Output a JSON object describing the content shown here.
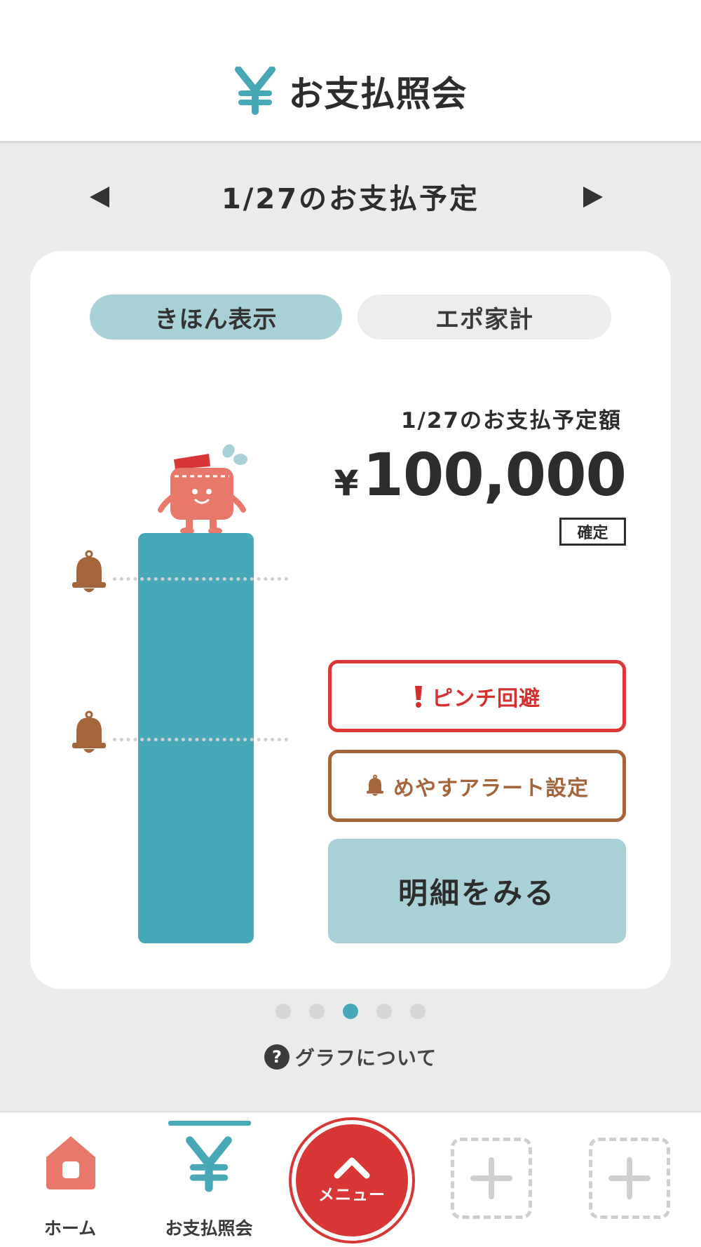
{
  "header": {
    "title": "お支払照会",
    "icon": "yen-icon"
  },
  "date_nav": {
    "title": "1/27のお支払予定",
    "prev_icon": "triangle-left-icon",
    "next_icon": "triangle-right-icon"
  },
  "segment": {
    "options": [
      {
        "label": "きほん表示",
        "selected": true
      },
      {
        "label": "エポ家計",
        "selected": false
      }
    ]
  },
  "summary": {
    "label": "1/27のお支払予定額",
    "currency": "¥",
    "amount": "100,000",
    "status": "確定"
  },
  "buttons": {
    "pinch": "ピンチ回避",
    "alert": "めやすアラート設定",
    "detail": "明細をみる"
  },
  "pager": {
    "count": 5,
    "active_index": 2
  },
  "help": {
    "icon_text": "?",
    "label": "グラフについて"
  },
  "tabbar": {
    "home": "ホーム",
    "payment": "お支払照会",
    "menu": "メニュー",
    "slots": [
      "add-icon",
      "add-icon"
    ]
  },
  "colors": {
    "teal": "#47a9b8",
    "light_teal": "#a7d1d6",
    "red": "#d93636",
    "brown": "#a5653a",
    "salmon": "#e8796a",
    "background": "#ebebeb"
  }
}
